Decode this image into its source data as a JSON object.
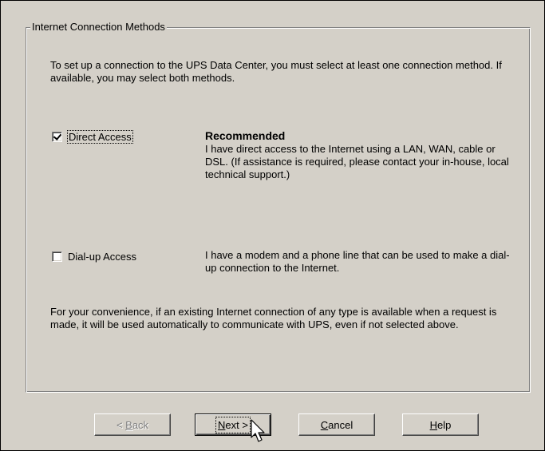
{
  "group": {
    "title": "Internet Connection Methods"
  },
  "intro_text": "To set up a connection to the UPS Data Center, you must select at least one connection method. If available, you may select both methods.",
  "options": [
    {
      "label": "Direct Access",
      "checked": true,
      "recommended": "Recommended",
      "description": "I have direct access to the Internet using a LAN, WAN, cable or DSL. (If assistance is required, please contact your in-house, local technical support.)"
    },
    {
      "label": "Dial-up Access",
      "checked": false,
      "description": "I have a modem and a phone line that can be used to make a dial-up connection to the Internet."
    }
  ],
  "footer_text": "For your convenience, if an existing Internet connection of any type is available when a request is made, it will be used automatically to communicate with UPS, even if not selected above.",
  "buttons": {
    "back": {
      "pre": "< ",
      "mnemonic": "B",
      "post": "ack",
      "enabled": false
    },
    "next": {
      "pre": "",
      "mnemonic": "N",
      "post": "ext >",
      "enabled": true
    },
    "cancel": {
      "pre": "",
      "mnemonic": "C",
      "post": "ancel",
      "enabled": true
    },
    "help": {
      "pre": "",
      "mnemonic": "H",
      "post": "elp",
      "enabled": true
    }
  },
  "colors": {
    "dialog_bg": "#d4d0c8",
    "disabled_text": "#808080"
  }
}
